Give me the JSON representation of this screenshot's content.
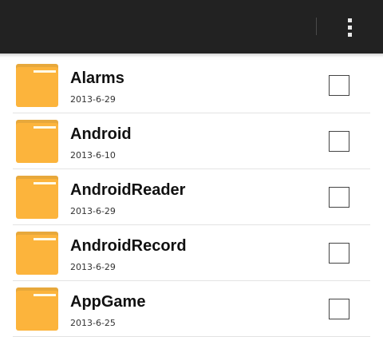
{
  "action_bar": {
    "overflow_icon": "overflow-menu-icon",
    "background": "#222222"
  },
  "folders": [
    {
      "name": "Alarms",
      "date": "2013-6-29",
      "checked": false
    },
    {
      "name": "Android",
      "date": "2013-6-10",
      "checked": false
    },
    {
      "name": "AndroidReader",
      "date": "2013-6-29",
      "checked": false
    },
    {
      "name": "AndroidRecord",
      "date": "2013-6-29",
      "checked": false
    },
    {
      "name": "AppGame",
      "date": "2013-6-25",
      "checked": false
    }
  ],
  "colors": {
    "folder": "#fcb43c",
    "folder_tab": "#e7a83b",
    "divider": "#e3e3e3"
  }
}
